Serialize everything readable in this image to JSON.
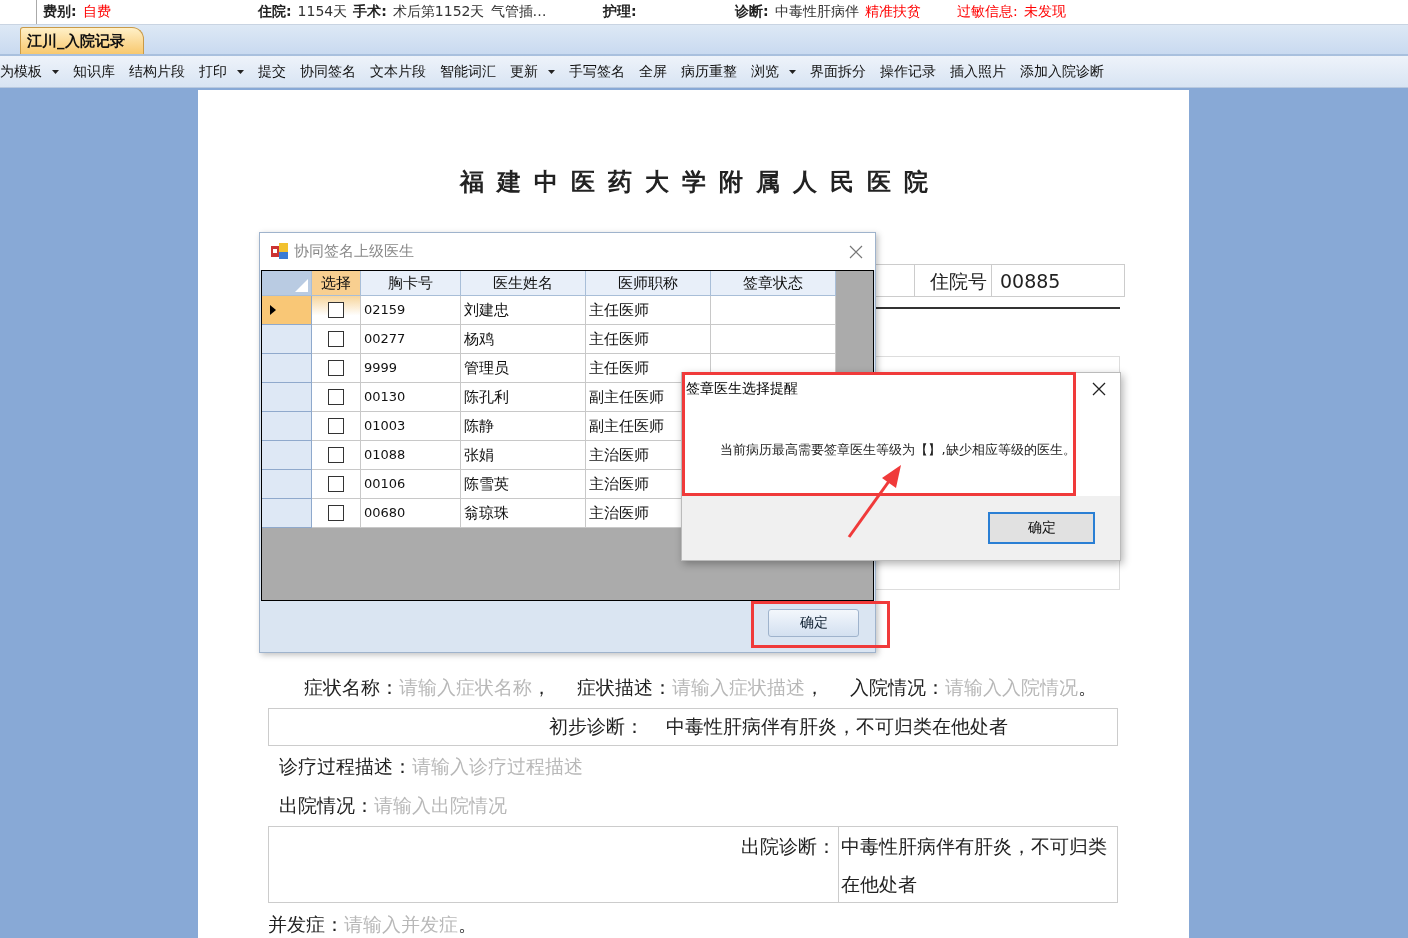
{
  "info_bar": [
    {
      "segments": [
        {
          "text": "费别:",
          "kind": "label"
        },
        {
          "text": "自费",
          "kind": "alert"
        }
      ]
    },
    {
      "segments": [
        {
          "text": "住院:",
          "kind": "label"
        },
        {
          "text": "1154天",
          "kind": "value"
        },
        {
          "text": "手术:",
          "kind": "label"
        },
        {
          "text": "术后第1152天",
          "kind": "value"
        },
        {
          "text": "气管插…",
          "kind": "value"
        }
      ]
    },
    {
      "segments": [
        {
          "text": "护理:",
          "kind": "label"
        }
      ]
    },
    {
      "segments": [
        {
          "text": "诊断:",
          "kind": "label"
        },
        {
          "text": "中毒性肝病伴",
          "kind": "value"
        },
        {
          "text": "精准扶贫",
          "kind": "alert"
        }
      ]
    },
    {
      "segments": [
        {
          "text": "过敏信息:",
          "kind": "alert"
        },
        {
          "text": "未发现",
          "kind": "alert"
        }
      ]
    }
  ],
  "tabs": [
    {
      "label": "江川_入院记录",
      "selected": true
    }
  ],
  "toolbar": [
    {
      "label": "为模板",
      "dropdown": true
    },
    {
      "label": "知识库",
      "dropdown": false
    },
    {
      "label": "结构片段",
      "dropdown": false
    },
    {
      "label": "打印",
      "dropdown": true
    },
    {
      "label": "提交",
      "dropdown": false
    },
    {
      "label": "协同签名",
      "dropdown": false
    },
    {
      "label": "文本片段",
      "dropdown": false
    },
    {
      "label": "智能词汇",
      "dropdown": false
    },
    {
      "label": "更新",
      "dropdown": true
    },
    {
      "label": "手写签名",
      "dropdown": false
    },
    {
      "label": "全屏",
      "dropdown": false
    },
    {
      "label": "病历重整",
      "dropdown": false
    },
    {
      "label": "浏览",
      "dropdown": true
    },
    {
      "label": "界面拆分",
      "dropdown": false
    },
    {
      "label": "操作记录",
      "dropdown": false
    },
    {
      "label": "插入照片",
      "dropdown": false
    },
    {
      "label": "添加入院诊断",
      "dropdown": false
    }
  ],
  "document": {
    "title": "福建中医药大学附属人民医院",
    "admission_no_label": "住院号",
    "admission_no": "00885",
    "symptom_fields": [
      {
        "label": "症状名称：",
        "placeholder": "请输入症状名称",
        "suffix": "，"
      },
      {
        "label": "症状描述：",
        "placeholder": "请输入症状描述",
        "suffix": "，"
      },
      {
        "label": "入院情况：",
        "placeholder": "请输入入院情况",
        "suffix": "。"
      }
    ],
    "initial_diagnosis_label": "初步诊断：",
    "initial_diagnosis": "中毒性肝病伴有肝炎，不可归类在他处者",
    "process_field": {
      "label": "诊疗过程描述：",
      "placeholder": "请输入诊疗过程描述"
    },
    "discharge_field": {
      "label": "出院情况：",
      "placeholder": "请输入出院情况"
    },
    "discharge_diagnosis_label": "出院诊断：",
    "discharge_diagnosis": "中毒性肝病伴有肝炎，不可归类在他处者",
    "complication_field": {
      "label": "并发症：",
      "placeholder": "请输入并发症",
      "suffix": "。"
    }
  },
  "sign_dialog": {
    "title": "协同签名上级医生",
    "columns": [
      {
        "label": "选择",
        "selected": true
      },
      {
        "label": "胸卡号",
        "selected": false
      },
      {
        "label": "医生姓名",
        "selected": false
      },
      {
        "label": "医师职称",
        "selected": false
      },
      {
        "label": "签章状态",
        "selected": false
      }
    ],
    "rows": [
      {
        "card_no": "02159",
        "name": "刘建忠",
        "title": "主任医师",
        "checked": false,
        "selected": true
      },
      {
        "card_no": "00277",
        "name": "杨鸡",
        "title": "主任医师",
        "checked": false,
        "selected": false
      },
      {
        "card_no": "9999",
        "name": "管理员",
        "title": "主任医师",
        "checked": false,
        "selected": false
      },
      {
        "card_no": "00130",
        "name": "陈孔利",
        "title": "副主任医师",
        "checked": false,
        "selected": false
      },
      {
        "card_no": "01003",
        "name": "陈静",
        "title": "副主任医师",
        "checked": false,
        "selected": false
      },
      {
        "card_no": "01088",
        "name": "张娟",
        "title": "主治医师",
        "checked": false,
        "selected": false
      },
      {
        "card_no": "00106",
        "name": "陈雪英",
        "title": "主治医师",
        "checked": false,
        "selected": false
      },
      {
        "card_no": "00680",
        "name": "翁琼珠",
        "title": "主治医师",
        "checked": false,
        "selected": false
      }
    ],
    "ok_button": "确定"
  },
  "alert_dialog": {
    "title": "签章医生选择提醒",
    "message": "当前病历最高需要签章医生等级为【】,缺少相应等级的医生。",
    "ok_button": "确定"
  }
}
